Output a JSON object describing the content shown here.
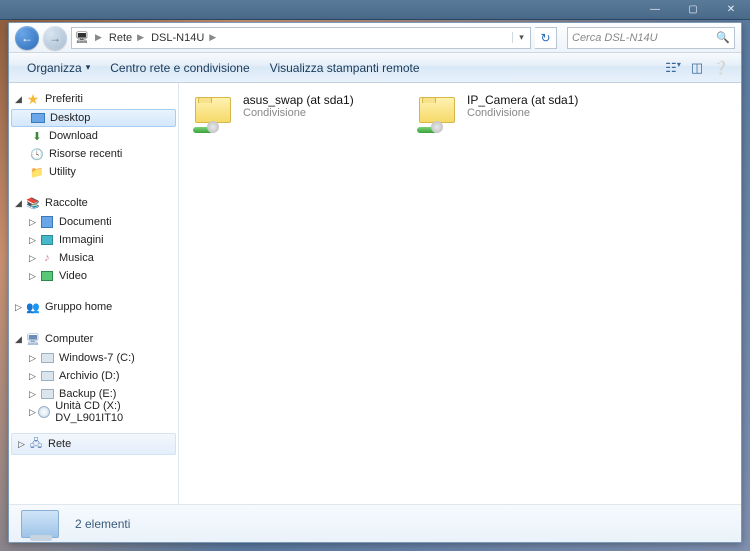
{
  "titlebar": {
    "min": "—",
    "max": "▢",
    "close": "✕"
  },
  "nav": {
    "breadcrumb": [
      "Rete",
      "DSL-N14U"
    ],
    "search_placeholder": "Cerca DSL-N14U"
  },
  "toolbar": {
    "organize": "Organizza",
    "network_center": "Centro rete e condivisione",
    "view_printers": "Visualizza stampanti remote"
  },
  "sidebar": {
    "favorites": {
      "label": "Preferiti",
      "items": [
        {
          "label": "Desktop",
          "selected": true,
          "icon": "desktop"
        },
        {
          "label": "Download",
          "icon": "download"
        },
        {
          "label": "Risorse recenti",
          "icon": "recent"
        },
        {
          "label": "Utility",
          "icon": "utility"
        }
      ]
    },
    "libraries": {
      "label": "Raccolte",
      "items": [
        {
          "label": "Documenti",
          "icon": "documents"
        },
        {
          "label": "Immagini",
          "icon": "pictures"
        },
        {
          "label": "Musica",
          "icon": "music"
        },
        {
          "label": "Video",
          "icon": "video"
        }
      ]
    },
    "homegroup": {
      "label": "Gruppo home"
    },
    "computer": {
      "label": "Computer",
      "items": [
        {
          "label": "Windows-7 (C:)",
          "icon": "drive"
        },
        {
          "label": "Archivio (D:)",
          "icon": "drive"
        },
        {
          "label": "Backup (E:)",
          "icon": "drive"
        },
        {
          "label": "Unità CD (X:) DV_L901IT10",
          "icon": "cd"
        }
      ]
    },
    "network": {
      "label": "Rete"
    }
  },
  "content": {
    "items": [
      {
        "name": "asus_swap (at sda1)",
        "sub": "Condivisione"
      },
      {
        "name": "IP_Camera (at sda1)",
        "sub": "Condivisione"
      }
    ]
  },
  "status": {
    "text": "2 elementi"
  }
}
